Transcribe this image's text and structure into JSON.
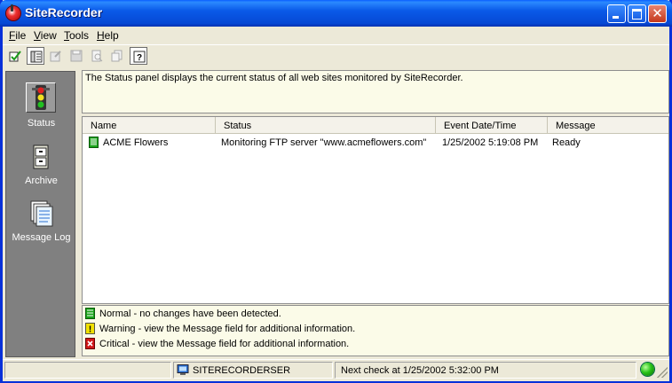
{
  "window": {
    "title": "SiteRecorder",
    "colors": {
      "titlebar": "#0a5ae8",
      "frame": "#0831d9",
      "close": "#c4381c",
      "panel_bg": "#fbfbe8",
      "sidebar_bg": "#808080"
    }
  },
  "menu": {
    "file_hot": "F",
    "file_rest": "ile",
    "view_hot": "V",
    "view_rest": "iew",
    "tools_hot": "T",
    "tools_rest": "ools",
    "help_hot": "H",
    "help_rest": "elp"
  },
  "toolbar": {
    "icons": [
      "check-edit-icon",
      "panel-view-icon",
      "properties-icon",
      "save-icon",
      "find-icon",
      "copy-icon",
      "help-icon"
    ]
  },
  "sidebar": {
    "items": [
      {
        "label": "Status",
        "icon": "traffic-light-icon",
        "selected": true
      },
      {
        "label": "Archive",
        "icon": "filing-cabinet-icon",
        "selected": false
      },
      {
        "label": "Message Log",
        "icon": "document-stack-icon",
        "selected": false
      }
    ]
  },
  "description": "The Status panel displays the current status of all web sites monitored by SiteRecorder.",
  "list": {
    "columns": [
      "Name",
      "Status",
      "Event Date/Time",
      "Message"
    ],
    "rows": [
      {
        "name": "ACME Flowers",
        "status": "Monitoring FTP server \"www.acmeflowers.com\"",
        "datetime": "1/25/2002 5:19:08 PM",
        "message": "Ready",
        "icon": "normal-status-icon"
      }
    ]
  },
  "legend": [
    {
      "text": "Normal - no changes have been detected.",
      "icon": "normal-status-icon",
      "color": "#1aa31a"
    },
    {
      "text": "Warning - view the Message field for additional information.",
      "icon": "warning-status-icon",
      "color": "#e8d800"
    },
    {
      "text": "Critical - view the Message field for additional information.",
      "icon": "critical-status-icon",
      "color": "#d01818"
    }
  ],
  "statusbar": {
    "computer": "SITERECORDERSER",
    "next_check": "Next check at 1/25/2002 5:32:00 PM",
    "indicator_color": "#27c217"
  }
}
